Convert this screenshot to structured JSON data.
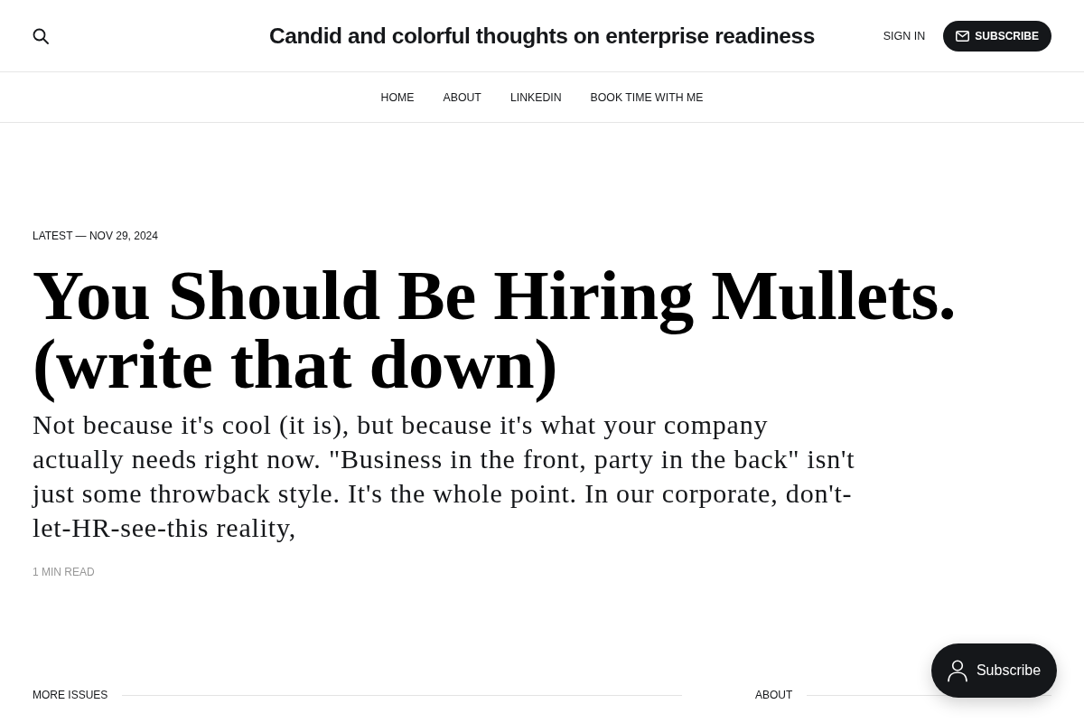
{
  "header": {
    "title": "Candid and colorful thoughts on enterprise readiness",
    "sign_in": "SIGN IN",
    "subscribe": "SUBSCRIBE"
  },
  "nav": [
    {
      "label": "HOME"
    },
    {
      "label": "ABOUT"
    },
    {
      "label": "LINKEDIN"
    },
    {
      "label": "BOOK TIME WITH ME"
    }
  ],
  "hero": {
    "meta": "LATEST — NOV 29, 2024",
    "title": "You Should Be Hiring Mullets. (write that down)",
    "excerpt": "Not because it's cool (it is), but because it's what your company actually needs right now. \"Business in the front, party in the back\" isn't just some throwback style. It's the whole point. In our corporate, don't-let-HR-see-this reality,",
    "reading_time": "1 MIN READ"
  },
  "sections": [
    {
      "label": "MORE ISSUES"
    },
    {
      "label": "ABOUT"
    }
  ],
  "portal_button": {
    "label": "Subscribe"
  }
}
